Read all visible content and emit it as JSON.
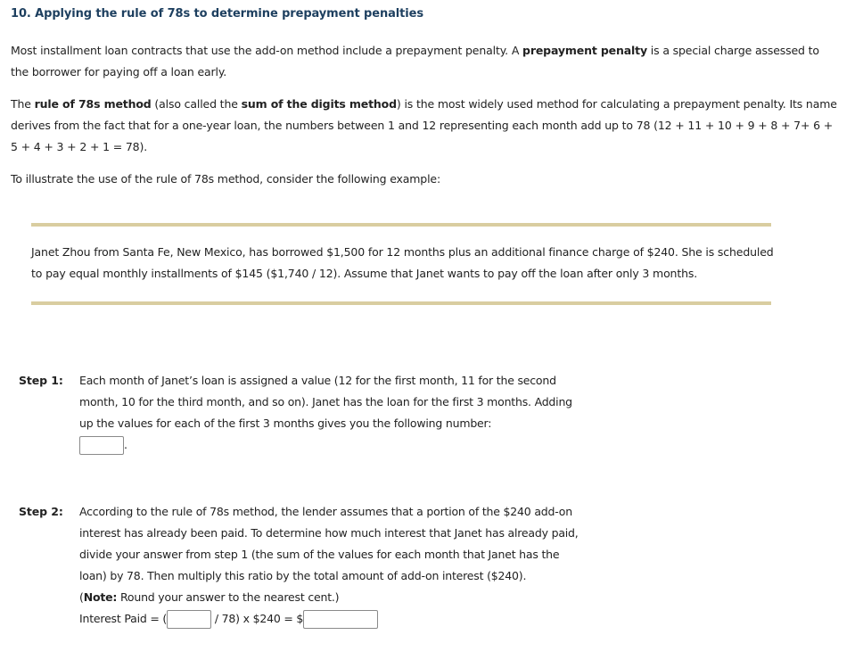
{
  "title": "10. Applying the rule of 78s to determine prepayment penalties",
  "intro": {
    "p1_a": "Most installment loan contracts that use the add-on method include a prepayment penalty. A ",
    "p1_bold": "prepayment penalty",
    "p1_b": " is a special charge assessed to the borrower for paying off a loan early.",
    "p2_a": "The ",
    "p2_bold1": "rule of 78s method",
    "p2_b": " (also called the ",
    "p2_bold2": "sum of the digits method",
    "p2_c": ") is the most widely used method for calculating a prepayment penalty. Its name derives from the fact that for a one-year loan, the numbers between 1 and 12 representing each month add up to 78 (12 + 11 + 10 + 9 + 8 + 7+ 6 + 5 + 4 + 3 + 2 + 1 = 78).",
    "p3": "To illustrate the use of the rule of 78s method, consider the following example:"
  },
  "example": {
    "text": "Janet Zhou from Santa Fe, New Mexico, has borrowed $1,500 for 12 months plus an additional finance charge of $240. She is scheduled to pay equal monthly installments of $145 ($1,740 / 12). Assume that Janet wants to pay off the loan after only 3 months."
  },
  "steps": {
    "step1": {
      "label": "Step 1:",
      "text": "Each month of Janet’s loan is assigned a value (12 for the first month, 11 for the second month, 10 for the third month, and so on). Janet has the loan for the first 3 months. Adding up the values for each of the first 3 months gives you the following number:",
      "answer_value": "",
      "after_box": "."
    },
    "step2": {
      "label": "Step 2:",
      "text": "According to the rule of 78s method, the lender assumes that a portion of the $240 add-on interest has already been paid. To determine how much interest that Janet has already paid, divide your answer from step 1 (the sum of the values for each month that Janet has the loan) by 78. Then multiply this ratio by the total amount of add-on interest ($240).",
      "note_open": "(",
      "note_bold": "Note:",
      "note_text": " Round your answer to the nearest cent.)",
      "eq_label": "Interest Paid = (",
      "eq_middle": " / 78) x $240 = $",
      "count_value": "",
      "interest_value": ""
    }
  },
  "colors": {
    "title": "#1d3f5f",
    "rule": "#d9cda0",
    "text": "#222222",
    "input_border": "#8a8a8a"
  }
}
